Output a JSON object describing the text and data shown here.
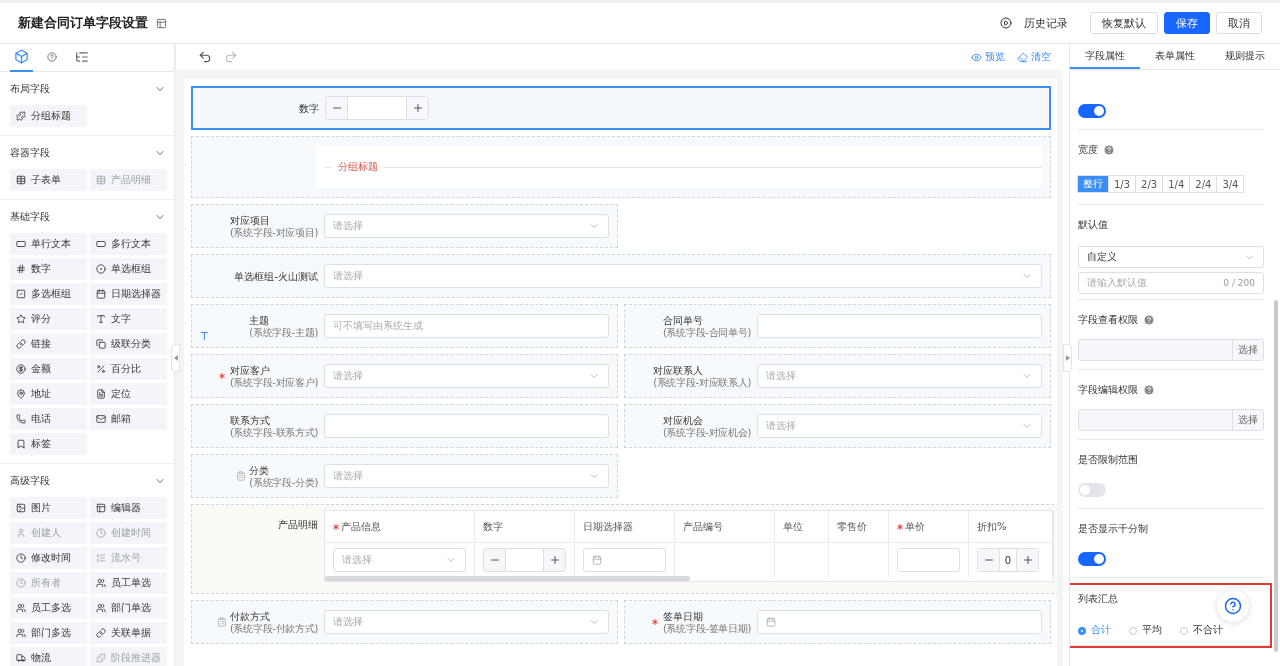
{
  "header": {
    "title": "新建合同订单字段设置",
    "history": "历史记录",
    "buttons": [
      {
        "label": "恢复默认",
        "kind": "default"
      },
      {
        "label": "保存",
        "kind": "primary"
      },
      {
        "label": "取消",
        "kind": "default"
      }
    ]
  },
  "sidebar": {
    "tabs": [
      {
        "selected": true
      },
      {
        "selected": false
      },
      {
        "selected": false
      }
    ],
    "sections": [
      {
        "title": "布局字段",
        "expanded": true,
        "items": [
          {
            "label": "分组标题",
            "disabled": false
          }
        ]
      },
      {
        "title": "容器字段",
        "expanded": true,
        "items": [
          {
            "label": "子表单",
            "disabled": false
          },
          {
            "label": "产品明细",
            "disabled": true
          }
        ]
      },
      {
        "title": "基础字段",
        "expanded": true,
        "items": [
          {
            "label": "单行文本",
            "disabled": false
          },
          {
            "label": "多行文本",
            "disabled": false
          },
          {
            "label": "数字",
            "disabled": false
          },
          {
            "label": "单选框组",
            "disabled": false
          },
          {
            "label": "多选框组",
            "disabled": false
          },
          {
            "label": "日期选择器",
            "disabled": false
          },
          {
            "label": "评分",
            "disabled": false
          },
          {
            "label": "文字",
            "disabled": false
          },
          {
            "label": "链接",
            "disabled": false
          },
          {
            "label": "级联分类",
            "disabled": false
          },
          {
            "label": "金额",
            "disabled": false
          },
          {
            "label": "百分比",
            "disabled": false
          },
          {
            "label": "地址",
            "disabled": false
          },
          {
            "label": "定位",
            "disabled": false
          },
          {
            "label": "电话",
            "disabled": false
          },
          {
            "label": "邮箱",
            "disabled": false
          },
          {
            "label": "标签",
            "disabled": false
          }
        ]
      },
      {
        "title": "高级字段",
        "expanded": true,
        "items": [
          {
            "label": "图片",
            "disabled": false
          },
          {
            "label": "编辑器",
            "disabled": false
          },
          {
            "label": "创建人",
            "disabled": true
          },
          {
            "label": "创建时间",
            "disabled": true
          },
          {
            "label": "修改时间",
            "disabled": false
          },
          {
            "label": "流水号",
            "disabled": true
          },
          {
            "label": "所有者",
            "disabled": true
          },
          {
            "label": "员工单选",
            "disabled": false
          },
          {
            "label": "员工多选",
            "disabled": false
          },
          {
            "label": "部门单选",
            "disabled": false
          },
          {
            "label": "部门多选",
            "disabled": false
          },
          {
            "label": "关联单据",
            "disabled": false
          },
          {
            "label": "物流",
            "disabled": false
          },
          {
            "label": "阶段推进器",
            "disabled": true
          }
        ]
      }
    ]
  },
  "canvas": {
    "toolbar": {
      "preview": "预览",
      "clear": "清空"
    },
    "rows": [
      {
        "cells": [
          {
            "kind": "number",
            "label": "数字",
            "full_width": true,
            "selected": true
          }
        ]
      },
      {
        "cells": [
          {
            "kind": "divider",
            "label": "分组标题",
            "full_width": true,
            "selected": false
          }
        ]
      },
      {
        "cells": [
          {
            "kind": "select",
            "label": "对应项目",
            "note": "(系统字段-对应项目)",
            "placeholder": "请选择",
            "required": false,
            "locked": false,
            "full_width": false,
            "selected": false
          }
        ]
      },
      {
        "cells": [
          {
            "kind": "select",
            "label": "单选框组-火山测试",
            "placeholder": "请选择",
            "required": false,
            "locked": false,
            "full_width": true,
            "selected": false
          }
        ]
      },
      {
        "cells": [
          {
            "kind": "text",
            "label": "主题",
            "note": "(系统字段-主题)",
            "placeholder": "可不填写由系统生成",
            "badge": "T",
            "required": false,
            "locked": false,
            "selected": false
          },
          {
            "kind": "text",
            "label": "合同单号",
            "note": "(系统字段-合同单号)",
            "required": false,
            "locked": false,
            "selected": false
          }
        ]
      },
      {
        "cells": [
          {
            "kind": "select",
            "label": "对应客户",
            "note": "(系统字段-对应客户)",
            "placeholder": "请选择",
            "required": true,
            "locked": false,
            "selected": false
          },
          {
            "kind": "select",
            "label": "对应联系人",
            "note": "(系统字段-对应联系人)",
            "placeholder": "请选择",
            "required": false,
            "locked": false,
            "selected": false
          }
        ]
      },
      {
        "cells": [
          {
            "kind": "text",
            "label": "联系方式",
            "note": "(系统字段-联系方式)",
            "required": false,
            "locked": false,
            "selected": false
          },
          {
            "kind": "select",
            "label": "对应机会",
            "note": "(系统字段-对应机会)",
            "placeholder": "请选择",
            "required": false,
            "locked": false,
            "selected": false
          }
        ]
      },
      {
        "cells": [
          {
            "kind": "select",
            "label": "分类",
            "note": "(系统字段-分类)",
            "placeholder": "请选择",
            "required": false,
            "locked": true,
            "full_width": false,
            "selected": false
          }
        ]
      },
      {
        "cells": [
          {
            "kind": "table",
            "label": "产品明细",
            "selected": false,
            "columns": [
              {
                "label": "产品信息",
                "required": true,
                "kind": "select",
                "placeholder": "请选择"
              },
              {
                "label": "数字",
                "required": false,
                "kind": "number"
              },
              {
                "label": "日期选择器",
                "required": false,
                "kind": "date"
              },
              {
                "label": "产品编号",
                "required": false,
                "kind": "empty"
              },
              {
                "label": "单位",
                "required": false,
                "kind": "empty"
              },
              {
                "label": "零售价",
                "required": false,
                "kind": "empty"
              },
              {
                "label": "单价",
                "required": true,
                "kind": "text"
              },
              {
                "label": "折扣%",
                "required": false,
                "kind": "number",
                "value": "0"
              }
            ]
          }
        ]
      },
      {
        "cells": [
          {
            "kind": "select",
            "label": "付款方式",
            "note": "(系统字段-付款方式)",
            "placeholder": "请选择",
            "required": false,
            "locked": true,
            "selected": false
          },
          {
            "kind": "date",
            "label": "签单日期",
            "note": "(系统字段-签单日期)",
            "required": true,
            "locked": false,
            "selected": false
          }
        ]
      }
    ]
  },
  "properties": {
    "tabs": [
      {
        "label": "字段属性",
        "selected": true
      },
      {
        "label": "表单属性",
        "selected": false
      },
      {
        "label": "规则提示",
        "selected": false
      }
    ],
    "sections": [
      {
        "kind": "toggle",
        "on": true
      },
      {
        "kind": "segmented",
        "label": "宽度",
        "help": true,
        "options": [
          {
            "label": "整行",
            "selected": true
          },
          {
            "label": "1/3",
            "selected": false
          },
          {
            "label": "2/3",
            "selected": false
          },
          {
            "label": "1/4",
            "selected": false
          },
          {
            "label": "2/4",
            "selected": false
          },
          {
            "label": "3/4",
            "selected": false
          }
        ]
      },
      {
        "kind": "default",
        "label": "默认值",
        "value": "自定义",
        "placeholder": "请输入默认值",
        "counter": "0 / 200"
      },
      {
        "kind": "picker",
        "label": "字段查看权限",
        "help": true,
        "button": "选择"
      },
      {
        "kind": "picker",
        "label": "字段编辑权限",
        "help": true,
        "button": "选择"
      },
      {
        "kind": "toggle",
        "label": "是否限制范围",
        "on": false
      },
      {
        "kind": "toggle",
        "label": "是否显示千分制",
        "on": true
      },
      {
        "kind": "radio",
        "label": "列表汇总",
        "highlighted": true,
        "options": [
          {
            "label": "合计",
            "selected": true
          },
          {
            "label": "平均",
            "selected": false
          },
          {
            "label": "不合计",
            "selected": false
          }
        ]
      }
    ]
  }
}
